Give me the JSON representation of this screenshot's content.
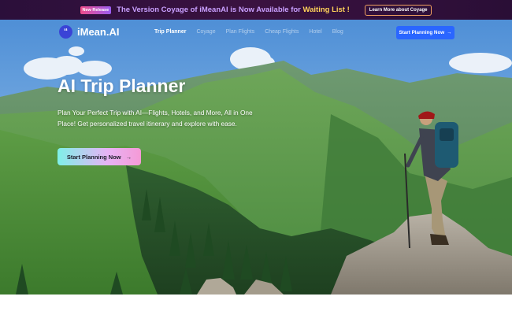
{
  "banner": {
    "badge": "New Release",
    "message_prefix": "The Version Coyage of iMeanAI is Now Available for ",
    "message_highlight": "Waiting List !",
    "learn_more": "Learn More about Coyage"
  },
  "nav": {
    "logo_mark": "“",
    "brand": "iMean.AI",
    "items": [
      {
        "label": "Trip Planner"
      },
      {
        "label": "Coyage"
      },
      {
        "label": "Plan Flights"
      },
      {
        "label": "Cheap Flights"
      },
      {
        "label": "Hotel"
      },
      {
        "label": "Blog"
      }
    ],
    "cta": "Start Planning Now",
    "cta_arrow": "→"
  },
  "hero": {
    "title": "AI Trip Planner",
    "subtitle": "Plan Your Perfect Trip with AI—Flights, Hotels, and More, All in One Place! Get personalized travel itinerary and explore with ease.",
    "cta": "Start Planning Now",
    "cta_arrow": "→"
  },
  "colors": {
    "banner_bg": "#2b0f3a",
    "highlight": "#ffd25a",
    "nav_cta": "#2a66ff",
    "sky": "#6fa6e0"
  }
}
